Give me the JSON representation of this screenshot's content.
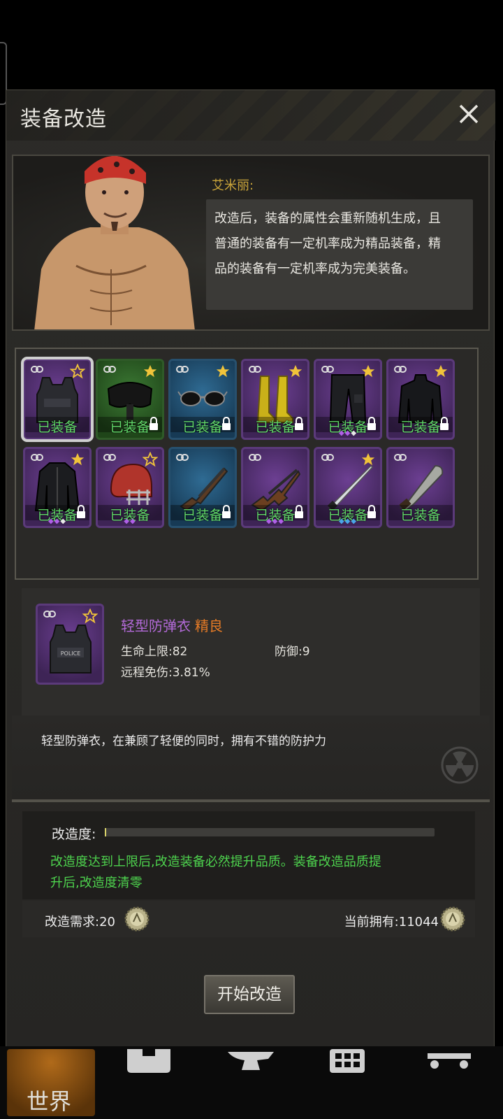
{
  "window": {
    "title": "装备改造"
  },
  "npc": {
    "name": "艾米丽:",
    "dialog_lines": [
      "改造后，装备的属性会重新随机生成，且",
      "普通的装备有一定机率成为精品装备，精",
      "品的装备有一定机率成为完美装备。"
    ]
  },
  "equipment": [
    {
      "item": "body-armor",
      "rarity": "purple",
      "equipped_label": "已装备",
      "star": "outline",
      "locked": false,
      "selected": true,
      "gems": []
    },
    {
      "item": "goggles",
      "rarity": "green",
      "equipped_label": "已装备",
      "star": "gold",
      "locked": true,
      "gems": []
    },
    {
      "item": "sunglasses",
      "rarity": "blue",
      "equipped_label": "已装备",
      "star": "gold",
      "locked": true,
      "gems": []
    },
    {
      "item": "boots",
      "rarity": "purple",
      "equipped_label": "已装备",
      "star": "gold",
      "locked": true,
      "gems": []
    },
    {
      "item": "cargo-pants",
      "rarity": "purple",
      "equipped_label": "已装备",
      "star": "gold",
      "locked": true,
      "gems": [
        "purple",
        "purple",
        "white"
      ]
    },
    {
      "item": "turtleneck-shirt",
      "rarity": "purple",
      "equipped_label": "已装备",
      "star": "gold",
      "locked": true,
      "gems": []
    },
    {
      "item": "leather-jacket",
      "rarity": "purple",
      "equipped_label": "已装备",
      "star": "gold",
      "locked": true,
      "gems": [
        "purple",
        "purple",
        "white"
      ]
    },
    {
      "item": "football-helmet",
      "rarity": "purple",
      "equipped_label": "已装备",
      "star": "outline",
      "locked": false,
      "gems": [
        "purple",
        "purple"
      ]
    },
    {
      "item": "shotgun",
      "rarity": "blue",
      "equipped_label": "已装备",
      "star": "none",
      "locked": true,
      "gems": []
    },
    {
      "item": "ak-rifle",
      "rarity": "purple",
      "equipped_label": "已装备",
      "star": "none",
      "locked": true,
      "gems": [
        "purple",
        "purple",
        "purple"
      ]
    },
    {
      "item": "katana",
      "rarity": "purple",
      "equipped_label": "已装备",
      "star": "gold",
      "locked": true,
      "gems": [
        "blue",
        "blue",
        "blue"
      ]
    },
    {
      "item": "machete",
      "rarity": "purple",
      "equipped_label": "已装备",
      "star": "none",
      "locked": false,
      "gems": []
    }
  ],
  "detail": {
    "name": "轻型防弹衣",
    "quality": "精良",
    "stats": {
      "hp": "生命上限:82",
      "defense": "防御:9",
      "ranged": "远程免伤:3.81%"
    },
    "vest_text": "POLICE",
    "description": "轻型防弹衣，在兼顾了轻便的同时，拥有不错的防护力"
  },
  "modify": {
    "progress_label": "改造度:",
    "progress_fraction": 0.005,
    "note_lines": [
      "改造度达到上限后,改造装备必然提升品质。装备改造品质提",
      "升后,改造度清零"
    ],
    "requirement": "改造需求:20",
    "owned": "当前拥有:11044",
    "start_button": "开始改造"
  },
  "nav": {
    "world": "世界"
  },
  "colors": {
    "accent_gold": "#c9a43a",
    "quality_orange": "#e47a26",
    "item_purple": "#b36ad8",
    "note_green": "#4ed44e",
    "equipped_green": "#62d96a"
  }
}
